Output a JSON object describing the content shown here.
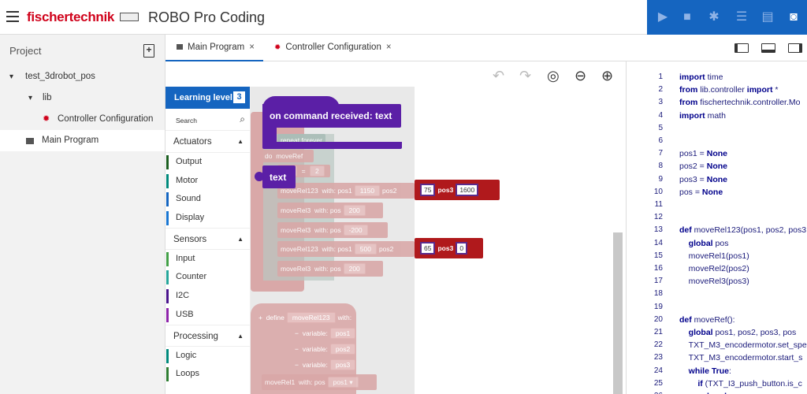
{
  "header": {
    "logo": "fischertechnik",
    "app_title": "ROBO Pro Coding"
  },
  "actions": [
    "play-icon",
    "stop-icon",
    "bug-icon",
    "sliders-icon",
    "file-icon",
    "controller-icon"
  ],
  "project": {
    "title": "Project",
    "tree": [
      {
        "label": "test_3drobot_pos",
        "level": 0,
        "caret": "▾"
      },
      {
        "label": "lib",
        "level": 1,
        "caret": "▾"
      },
      {
        "label": "Controller Configuration",
        "level": 2,
        "icon": "gear-icon"
      },
      {
        "label": "Main Program",
        "level": 1,
        "icon": "book-icon",
        "selected": true
      }
    ]
  },
  "tabs": [
    {
      "label": "Main Program",
      "close": "×",
      "icon": "book-icon"
    },
    {
      "label": "Controller Configuration",
      "close": "×",
      "icon": "gear-icon"
    }
  ],
  "palette": {
    "learning_label": "Learning level",
    "learning_value": "3",
    "search_label": "Search",
    "categories": [
      {
        "name": "Actuators",
        "items": [
          {
            "label": "Output",
            "color": "#1b5e20"
          },
          {
            "label": "Motor",
            "color": "#00897b"
          },
          {
            "label": "Sound",
            "color": "#1565c0"
          },
          {
            "label": "Display",
            "color": "#1976d2"
          }
        ]
      },
      {
        "name": "Sensors",
        "items": [
          {
            "label": "Input",
            "color": "#43a047"
          },
          {
            "label": "Counter",
            "color": "#26a69a"
          },
          {
            "label": "I2C",
            "color": "#4a148c"
          },
          {
            "label": "USB",
            "color": "#8e24aa"
          }
        ]
      },
      {
        "name": "Processing",
        "items": [
          {
            "label": "Logic",
            "color": "#00897b"
          },
          {
            "label": "Loops",
            "color": "#2e7d32"
          }
        ]
      }
    ]
  },
  "blocks": {
    "event": "on command received: text",
    "text_var": "text",
    "repeat": "repeat forever",
    "do": "do",
    "moveRef": "moveRef",
    "set_x": "x",
    "val2": "2",
    "moveRel123": "moveRel123",
    "with": "with:",
    "pos1": "pos1",
    "pos2": "pos2",
    "pos3": "pos3",
    "pos": "pos",
    "v1150": "1150",
    "v75": "75",
    "v1600": "1600",
    "moveRel3": "moveRel3",
    "v200": "200",
    "v_200": "-200",
    "v500": "500",
    "v65": "65",
    "v0": "0",
    "define": "define",
    "variable": "variable:",
    "moveRel1": "moveRel1",
    "dropdown": "▾"
  },
  "code": [
    {
      "n": "1",
      "t": [
        [
          "import ",
          "kw"
        ],
        [
          "time",
          ""
        ]
      ]
    },
    {
      "n": "2",
      "t": [
        [
          "from ",
          "kw"
        ],
        [
          "lib.controller ",
          ""
        ],
        [
          "import ",
          "kw"
        ],
        [
          "*",
          ""
        ]
      ]
    },
    {
      "n": "3",
      "t": [
        [
          "from ",
          "kw"
        ],
        [
          "fischertechnik.controller.Mo",
          ""
        ]
      ]
    },
    {
      "n": "4",
      "t": [
        [
          "import ",
          "kw"
        ],
        [
          "math",
          ""
        ]
      ]
    },
    {
      "n": "5",
      "t": []
    },
    {
      "n": "6",
      "t": []
    },
    {
      "n": "7",
      "t": [
        [
          "pos1 = ",
          ""
        ],
        [
          "None",
          "kw"
        ]
      ]
    },
    {
      "n": "8",
      "t": [
        [
          "pos2 = ",
          ""
        ],
        [
          "None",
          "kw"
        ]
      ]
    },
    {
      "n": "9",
      "t": [
        [
          "pos3 = ",
          ""
        ],
        [
          "None",
          "kw"
        ]
      ]
    },
    {
      "n": "10",
      "t": [
        [
          "pos = ",
          ""
        ],
        [
          "None",
          "kw"
        ]
      ]
    },
    {
      "n": "11",
      "t": []
    },
    {
      "n": "12",
      "t": []
    },
    {
      "n": "13",
      "t": [
        [
          "def ",
          "kw"
        ],
        [
          "moveRel123(pos1, pos2, pos3",
          ""
        ]
      ]
    },
    {
      "n": "14",
      "t": [
        [
          "  global ",
          "kw"
        ],
        [
          "pos",
          ""
        ]
      ]
    },
    {
      "n": "15",
      "t": [
        [
          "  moveRel1(pos1)",
          ""
        ]
      ]
    },
    {
      "n": "16",
      "t": [
        [
          "  moveRel2(pos2)",
          ""
        ]
      ]
    },
    {
      "n": "17",
      "t": [
        [
          "  moveRel3(pos3)",
          ""
        ]
      ]
    },
    {
      "n": "18",
      "t": []
    },
    {
      "n": "19",
      "t": []
    },
    {
      "n": "20",
      "t": [
        [
          "def ",
          "kw"
        ],
        [
          "moveRef():",
          ""
        ]
      ]
    },
    {
      "n": "21",
      "t": [
        [
          "  global ",
          "kw"
        ],
        [
          "pos1, pos2, pos3, pos",
          ""
        ]
      ]
    },
    {
      "n": "22",
      "t": [
        [
          "  TXT_M3_encodermotor.set_spe",
          ""
        ]
      ]
    },
    {
      "n": "23",
      "t": [
        [
          "  TXT_M3_encodermotor.start_s",
          ""
        ]
      ]
    },
    {
      "n": "24",
      "t": [
        [
          "  while ",
          "kw"
        ],
        [
          "True",
          "kw"
        ],
        [
          ":",
          ""
        ]
      ]
    },
    {
      "n": "25",
      "t": [
        [
          "    if ",
          "kw"
        ],
        [
          "(TXT_I3_push_button.is_c",
          ""
        ]
      ]
    },
    {
      "n": "26",
      "t": [
        [
          "      break",
          "kw"
        ]
      ]
    }
  ]
}
